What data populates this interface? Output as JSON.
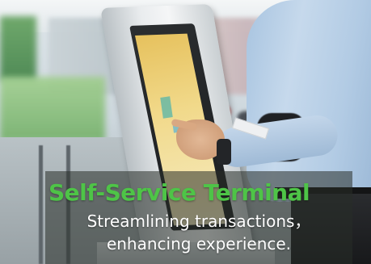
{
  "banner": {
    "title": "Self-Service Terminal",
    "subtitle_line1": "Streamlining transactions，",
    "subtitle_line2": "enhancing experience."
  },
  "colors": {
    "title_green": "#4ec447",
    "subtitle_white": "#ffffff",
    "kiosk_screen_yellow": "#e6c15d",
    "shirt_blue": "#b2cbe4"
  },
  "icons": {
    "kiosk": "kiosk-terminal-illustration",
    "person": "person-touching-screen-illustration"
  }
}
